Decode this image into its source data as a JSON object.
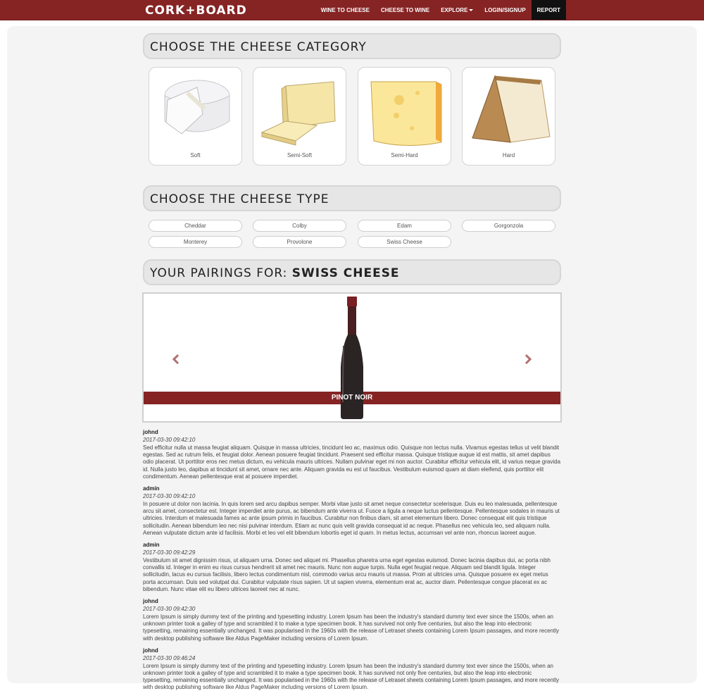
{
  "brand": "CORK+BOARD",
  "nav": {
    "wine_to_cheese": "WINE TO CHEESE",
    "cheese_to_wine": "CHEESE TO WINE",
    "explore": "EXPLORE",
    "login": "LOGIN/SIGNUP",
    "report": "REPORT"
  },
  "category_heading": "CHOOSE THE CHEESE CATEGORY",
  "categories": [
    {
      "label": "Soft"
    },
    {
      "label": "Semi-Soft"
    },
    {
      "label": "Semi-Hard"
    },
    {
      "label": "Hard"
    }
  ],
  "type_heading": "CHOOSE THE CHEESE TYPE",
  "types": [
    "Cheddar",
    "Colby",
    "Edam",
    "Gorgonzola",
    "Monterey",
    "Provolone",
    "Swiss Cheese"
  ],
  "pairings": {
    "prefix": "YOUR PAIRINGS FOR:",
    "cheese": "SWISS CHEESE",
    "wine": "PINOT NOIR"
  },
  "comments": [
    {
      "user": "johnd",
      "date": "2017-03-30 09:42:10",
      "text": "Sed efficitur nulla ut massa feugiat aliquam. Quisque in massa ultricies, tincidunt leo ac, maximus odio. Quisque non lectus nulla. Vivamus egestas tellus ut velit blandit egestas. Sed ac rutrum felis, et feugiat dolor. Aenean posuere feugiat tincidunt. Praesent sed efficitur massa. Quisque tristique augue id est mattis, sit amet dapibus odio placerat. Ut porttitor eros nec metus dictum, eu vehicula mauris ultrices. Nullam pulvinar eget mi non auctor. Curabitur efficitur vehicula elit, id varius neque gravida id. Nulla justo leo, dapibus at tincidunt sit amet, ornare nec ante. Aliquam gravida eu est ut faucibus. Vestibulum euismod quam at diam eleifend, quis porttitor elit condimentum. Aenean pellentesque erat at posuere imperdiet."
    },
    {
      "user": "admin",
      "date": "2017-03-30 09:42:10",
      "text": "In posuere ut dolor non lacinia. In quis lorem sed arcu dapibus semper. Morbi vitae justo sit amet neque consectetur scelerisque. Duis eu leo malesuada, pellentesque arcu sit amet, consectetur est. Integer imperdiet ante purus, ac bibendum ante viverra ut. Fusce a ligula a neque luctus pellentesque. Pellentesque sodales in mauris ut ultricies. Interdum et malesuada fames ac ante ipsum primis in faucibus. Curabitur non finibus diam, sit amet elementum libero. Donec consequat elit quis tristique sollicitudin. Aenean bibendum leo nec nisi pulvinar interdum. Etiam ac nunc quis velit gravida consequat id ac neque. Phasellus nec vehicula leo, sed aliquam nulla. Aenean vulputate dictum ante id facilisis. Morbi et leo vel elit bibendum lobortis eget id quam. In metus lectus, accumsan vel ante non, rhoncus laoreet augue."
    },
    {
      "user": "admin",
      "date": "2017-03-30 09:42:29",
      "text": "Vestibulum sit amet dignissim risus, ut aliquam urna. Donec sed aliquet mi. Phasellus pharetra urna eget egestas euismod. Donec lacinia dapibus dui, ac porta nibh convallis id. Integer in enim eu risus cursus hendrerit sit amet nec mauris. Nunc non augue turpis. Nulla eget feugiat neque. Aliquam sed blandit ligula. Integer sollicitudin, lacus eu cursus facilisis, libero lectus condimentum nisl, commodo varius arcu mauris ut massa. Proin at ultricies urna. Quisque posuere ex eget metus porta accumsan. Duis sed volutpat dui. Curabitur vulputate risus sapien. Ut ut sapien viverra, elementum erat ac, auctor diam. Pellentesque congue placerat ex ac bibendum. Nunc vitae elit eu libero ultrices laoreet nec at nunc."
    },
    {
      "user": "johnd",
      "date": "2017-03-30 09:42:30",
      "text": "Lorem Ipsum is simply dummy text of the printing and typesetting industry. Lorem Ipsum has been the industry's standard dummy text ever since the 1500s, when an unknown printer took a galley of type and scrambled it to make a type specimen book. It has survived not only five centuries, but also the leap into electronic typesetting, remaining essentially unchanged. It was popularised in the 1960s with the release of Letraset sheets containing Lorem Ipsum passages, and more recently with desktop publishing software like Aldus PageMaker including versions of Lorem Ipsum."
    },
    {
      "user": "johnd",
      "date": "2017-03-30 09:46:24",
      "text": "Lorem Ipsum is simply dummy text of the printing and typesetting industry. Lorem Ipsum has been the industry's standard dummy text ever since the 1500s, when an unknown printer took a galley of type and scrambled it to make a type specimen book. It has survived not only five centuries, but also the leap into electronic typesetting, remaining essentially unchanged. It was popularised in the 1960s with the release of Letraset sheets containing Lorem Ipsum passages, and more recently with desktop publishing software like Aldus PageMaker including versions of Lorem Ipsum."
    }
  ]
}
